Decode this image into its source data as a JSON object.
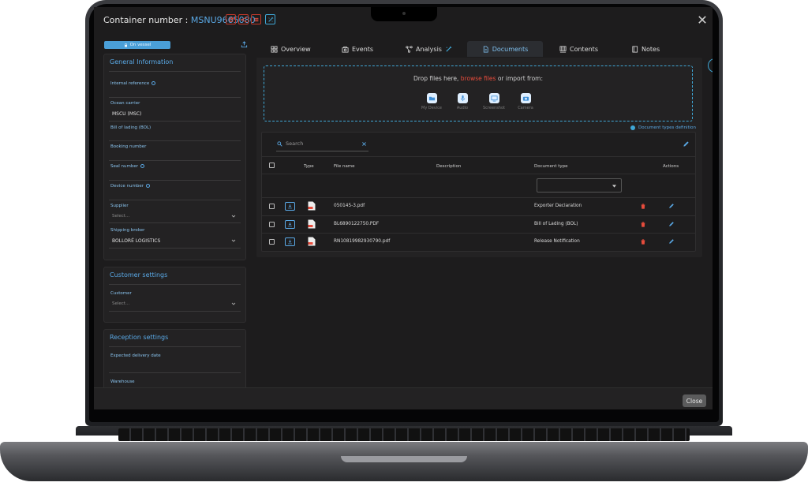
{
  "window": {
    "title_label": "Container number : ",
    "container_number": "MSNU9665080"
  },
  "left": {
    "vessel_badge": "On vessel",
    "general": {
      "title": "General Information",
      "internal_reference": "Internal reference",
      "ocean_carrier_label": "Ocean carrier",
      "ocean_carrier_value": "MSCU (MSC)",
      "bol_label": "Bill of lading (BOL)",
      "booking_label": "Booking number",
      "seal_label": "Seal number",
      "device_label": "Device number",
      "supplier_label": "Supplier",
      "supplier_placeholder": "Select...",
      "broker_label": "Shipping broker",
      "broker_value": "BOLLORÉ LOGISTICS"
    },
    "customer": {
      "title": "Customer settings",
      "customer_label": "Customer",
      "customer_placeholder": "Select..."
    },
    "reception": {
      "title": "Reception settings",
      "delivery_label": "Expected delivery date",
      "warehouse_label": "Warehouse"
    }
  },
  "tabs": [
    {
      "label": "Overview",
      "icon": "grid-icon"
    },
    {
      "label": "Events",
      "icon": "camera-box-icon"
    },
    {
      "label": "Analysis",
      "icon": "nodes-icon"
    },
    {
      "label": "Documents",
      "icon": "document-icon",
      "active": true
    },
    {
      "label": "Contents",
      "icon": "boxes-icon"
    },
    {
      "label": "Notes",
      "icon": "notebook-icon"
    }
  ],
  "documents": {
    "drop_prefix": "Drop files here, ",
    "drop_link": "browse files",
    "drop_suffix": " or import from:",
    "sources": [
      "My Device",
      "Audio",
      "Screenshot",
      "Camera"
    ],
    "doc_types_link": "Document types definition",
    "search_placeholder": "Search",
    "columns": {
      "type": "Type",
      "file_name": "File name",
      "description": "Description",
      "document_type": "Document type",
      "actions": "Actions"
    },
    "rows": [
      {
        "file_name": "050145-3.pdf",
        "description": "",
        "document_type": "Exporter Declaration"
      },
      {
        "file_name": "BL6890122750.PDF",
        "description": "",
        "document_type": "Bill of Lading (BOL)"
      },
      {
        "file_name": "RN10819982930790.pdf",
        "description": "",
        "document_type": "Release Notification"
      }
    ]
  },
  "footer": {
    "close_label": "Close"
  },
  "colors": {
    "accent": "#5aa9e6",
    "danger": "#e74c3c",
    "background": "#1d1c1d"
  }
}
